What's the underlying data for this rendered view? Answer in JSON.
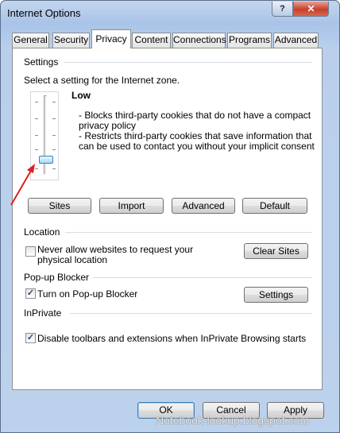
{
  "window": {
    "title": "Internet Options",
    "help_label": "?",
    "close_label": "✕"
  },
  "tabs": [
    {
      "label": "General"
    },
    {
      "label": "Security"
    },
    {
      "label": "Privacy"
    },
    {
      "label": "Content"
    },
    {
      "label": "Connections"
    },
    {
      "label": "Programs"
    },
    {
      "label": "Advanced"
    }
  ],
  "settings": {
    "heading": "Settings",
    "zone_prompt": "Select a setting for the Internet zone.",
    "level": "Low",
    "slider_level_fraction": 0.2,
    "description_lines": [
      "- Blocks third-party cookies that do not have a compact",
      "privacy policy",
      "- Restricts third-party cookies that save information that",
      "can be used to contact you without your implicit consent"
    ],
    "buttons": {
      "sites": "Sites",
      "import": "Import",
      "advanced": "Advanced",
      "default": "Default"
    }
  },
  "location": {
    "heading": "Location",
    "checkbox_lines": [
      "Never allow websites to request your",
      "physical location"
    ],
    "checked": false,
    "clear_sites": "Clear Sites"
  },
  "popup": {
    "heading": "Pop-up Blocker",
    "checkbox_label": "Turn on Pop-up Blocker",
    "checked": true,
    "settings_button": "Settings"
  },
  "inprivate": {
    "heading": "InPrivate",
    "checkbox_label": "Disable toolbars and extensions when InPrivate Browsing starts",
    "checked": true
  },
  "footer": {
    "ok": "OK",
    "cancel": "Cancel",
    "apply": "Apply"
  },
  "watermark": "Notebook-lookup.blogspot.com",
  "check_mark": "✓",
  "colors": {
    "annotation_arrow": "#e02020",
    "default_button_border": "#3c7fb1"
  }
}
